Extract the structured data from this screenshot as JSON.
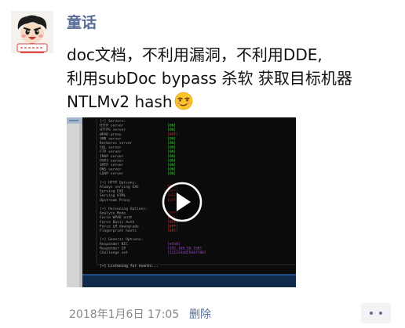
{
  "post": {
    "author": "童话",
    "text_lines": [
      "doc文档，不利用漏洞，不利用DDE,",
      "利用subDoc bypass 杀软 获取目标机器",
      "NTLMv2 hash"
    ],
    "emoji": "smirk-face-emoji"
  },
  "video": {
    "screen_lines": [
      "[+] Servers:",
      "    HTTP server",
      "    HTTPS server",
      "    WPAD proxy",
      "    SMB server",
      "    Kerberos server",
      "    SQL server",
      "    FTP server",
      "    IMAP server",
      "    POP3 server",
      "    SMTP server",
      "    DNS server",
      "    LDAP server",
      "",
      "[+] HTTP Options:",
      "    Always serving EXE",
      "    Serving EXE",
      "    Serving HTML",
      "    Upstream Proxy",
      "",
      "[+] Poisoning Options:",
      "    Analyze Mode",
      "    Force WPAD auth",
      "    Force Basic Auth",
      "    Force LM downgrade",
      "    Fingerprint hosts",
      "",
      "[+] Generic Options:",
      "    Responder NIC",
      "    Responder IP",
      "    Challenge set",
      "",
      "",
      "[+] Listening for events..."
    ],
    "status_values": [
      "[ON]",
      "[ON]",
      "[OFF]",
      "[ON]",
      "[ON]",
      "[ON]",
      "[ON]",
      "[ON]",
      "[ON]",
      "[ON]",
      "[ON]",
      "[ON]",
      "[OFF]",
      "[OFF]",
      "[OFF]",
      "[OFF]",
      "[OFF]",
      "[OFF]",
      "[OFF]",
      "[OFF]",
      "[OFF]",
      "[eth0]",
      "[192.168.50.198]",
      "[1122334455667788]"
    ],
    "colors": {
      "terminal_bg": "#0a0a0a",
      "text": "#9e9e9e",
      "on_green": "#3ec93e",
      "off_red": "#d33a3a",
      "purple": "#a14ad0",
      "listen": "#c9c9c9"
    }
  },
  "footer": {
    "time": "2018年1月6日 17:05",
    "delete_label": "删除",
    "comment_icon": "comment-more-icon"
  }
}
